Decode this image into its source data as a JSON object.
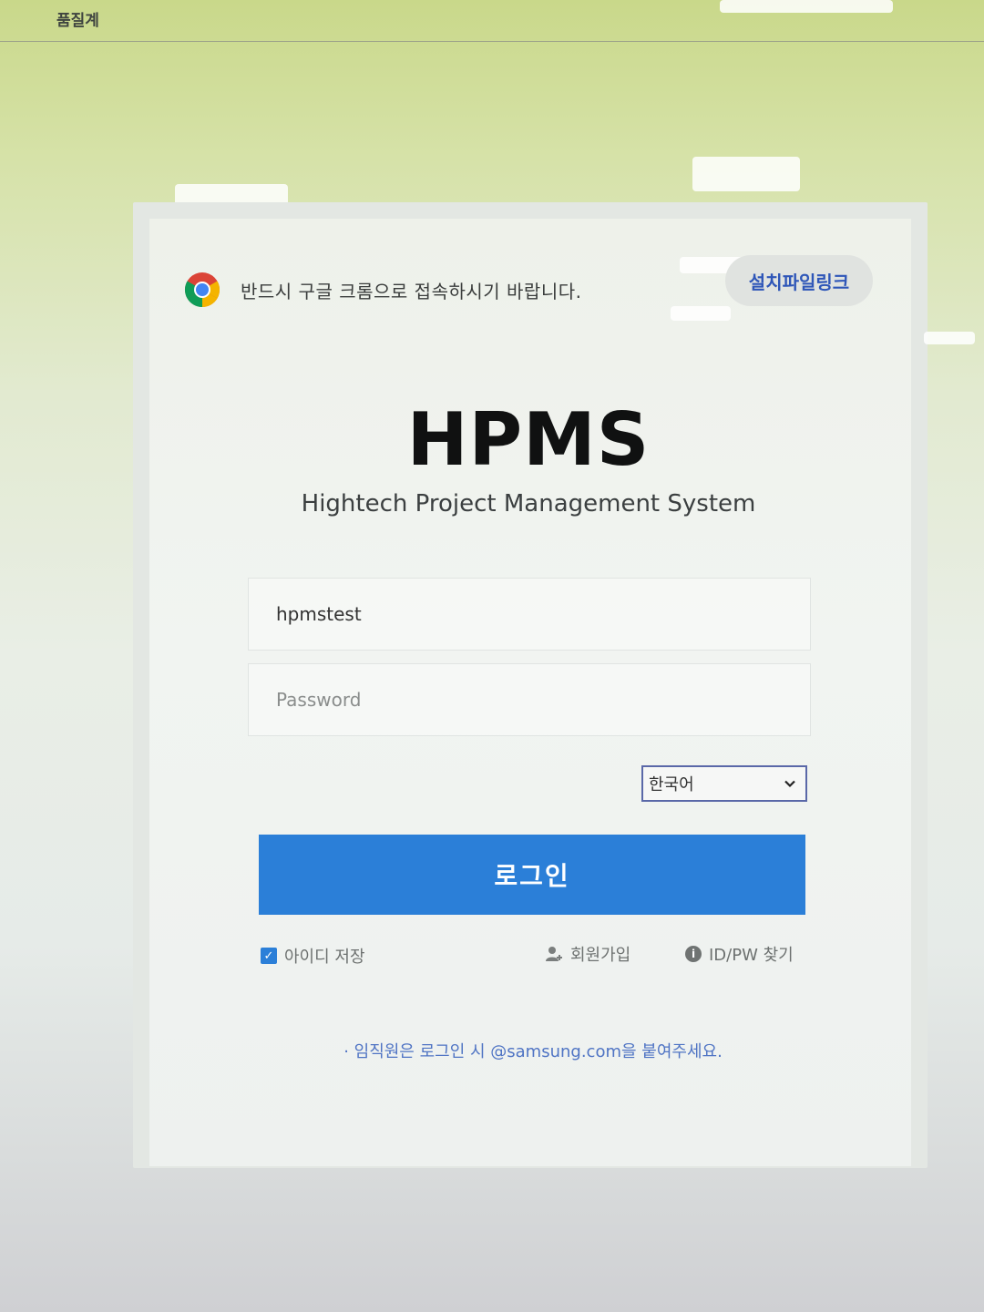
{
  "topbar": {
    "label": "품질계"
  },
  "notice": {
    "text": "반드시 구글 크롬으로 접속하시기 바랍니다."
  },
  "install_link": {
    "label": "설치파일링크"
  },
  "app": {
    "title": "HPMS",
    "subtitle": "Hightech Project Management System"
  },
  "form": {
    "userid_value": "hpmstest",
    "password_placeholder": "Password",
    "language": "한국어",
    "login_label": "로그인"
  },
  "options": {
    "save_id_label": "아이디 저장",
    "save_id_checked": true,
    "signup_label": "회원가입",
    "find_label": "ID/PW 찾기"
  },
  "footer": {
    "notice": "· 임직원은 로그인 시 @samsung.com을 붙여주세요."
  },
  "colors": {
    "login_button": "#2b7fd8",
    "link": "#2e56b8",
    "footer_text": "#4f74c4"
  },
  "icons": {
    "browser": "chrome-icon",
    "signup": "user-add-icon",
    "find": "info-icon",
    "dropdown": "chevron-down-icon"
  }
}
